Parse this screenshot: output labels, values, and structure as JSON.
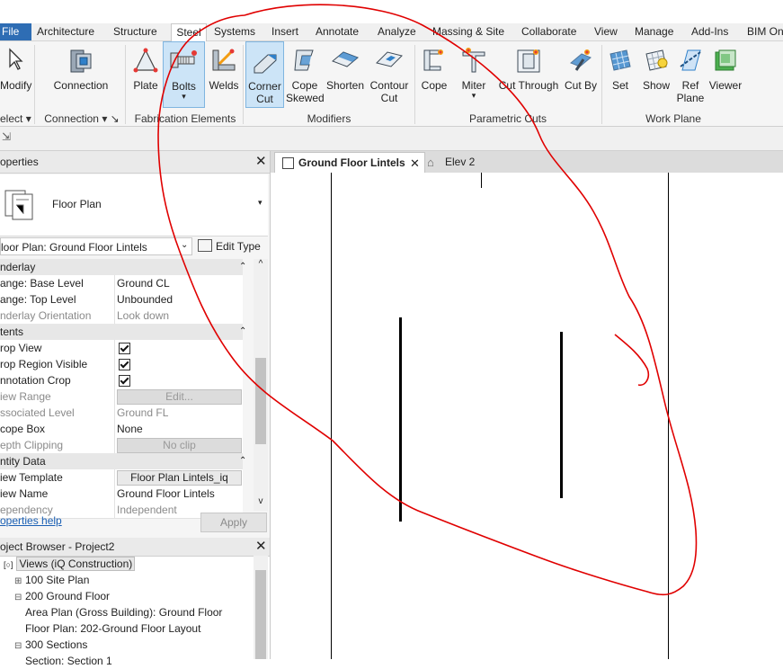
{
  "ribbon_tabs": [
    "File",
    "Architecture",
    "Structure",
    "Steel",
    "Systems",
    "Insert",
    "Annotate",
    "Analyze",
    "Massing & Site",
    "Collaborate",
    "View",
    "Manage",
    "Add-Ins",
    "BIM On"
  ],
  "ribbon_active_tab": "Steel",
  "tools": {
    "modify": "Modify",
    "select": "elect",
    "connection": "Connection",
    "connection_panel": "Connection",
    "plate": "Plate",
    "bolts": "Bolts",
    "welds": "Welds",
    "fabrication_panel": "Fabrication Elements",
    "corner_cut_1": "Corner",
    "corner_cut_2": "Cut",
    "cope_skewed_1": "Cope",
    "cope_skewed_2": "Skewed",
    "shorten": "Shorten",
    "contour_cut_1": "Contour",
    "contour_cut_2": "Cut",
    "modifiers_panel": "Modifiers",
    "cope": "Cope",
    "miter": "Miter",
    "cut_through": "Cut Through",
    "cut_by": "Cut By",
    "parametric_panel": "Parametric Cuts",
    "set": "Set",
    "show": "Show",
    "ref_plane_1": "Ref",
    "ref_plane_2": "Plane",
    "viewer": "Viewer",
    "workplane_panel": "Work Plane"
  },
  "properties": {
    "title": "operties",
    "type_name": "Floor Plan",
    "instance_selector": "loor Plan: Ground Floor Lintels",
    "edit_type": "Edit Type",
    "rows": [
      {
        "k": "nderlay",
        "v": "",
        "group": true
      },
      {
        "k": "ange: Base Level",
        "v": "Ground CL"
      },
      {
        "k": "ange: Top Level",
        "v": "Unbounded"
      },
      {
        "k": "nderlay Orientation",
        "v": "Look down",
        "dim": true
      },
      {
        "k": "tents",
        "v": "",
        "group": true
      },
      {
        "k": "rop View",
        "v": "",
        "check": true
      },
      {
        "k": "rop Region Visible",
        "v": "",
        "check": true
      },
      {
        "k": "nnotation Crop",
        "v": "",
        "check": true
      },
      {
        "k": "iew Range",
        "v": "Edit...",
        "dim": true,
        "button": true
      },
      {
        "k": "ssociated Level",
        "v": "Ground FL",
        "dim": true
      },
      {
        "k": "cope Box",
        "v": "None"
      },
      {
        "k": "epth Clipping",
        "v": "No clip",
        "dim": true,
        "button": true
      },
      {
        "k": "ntity Data",
        "v": "",
        "group": true
      },
      {
        "k": "iew Template",
        "v": "Floor Plan Lintels_iq",
        "button": true,
        "dark": true
      },
      {
        "k": "iew Name",
        "v": "Ground Floor Lintels"
      },
      {
        "k": "ependency",
        "v": "Independent",
        "dim": true
      }
    ],
    "help_link": "operties help",
    "apply": "Apply"
  },
  "browser": {
    "title": "oject Browser - Project2",
    "items": [
      {
        "label": "Views (iQ Construction)",
        "indent": 0,
        "sel": true
      },
      {
        "label": "100 Site Plan",
        "indent": 1,
        "exp": "+"
      },
      {
        "label": "200 Ground Floor",
        "indent": 1,
        "exp": "-"
      },
      {
        "label": "Area Plan (Gross Building): Ground Floor",
        "indent": 2
      },
      {
        "label": "Floor Plan: 202-Ground Floor Layout",
        "indent": 2
      },
      {
        "label": "300 Sections",
        "indent": 1,
        "exp": "-"
      },
      {
        "label": "Section: Section 1",
        "indent": 2
      }
    ]
  },
  "view_tabs": [
    {
      "label": "Ground Floor Lintels",
      "active": true
    },
    {
      "label": "Elev 2",
      "active": false
    }
  ]
}
